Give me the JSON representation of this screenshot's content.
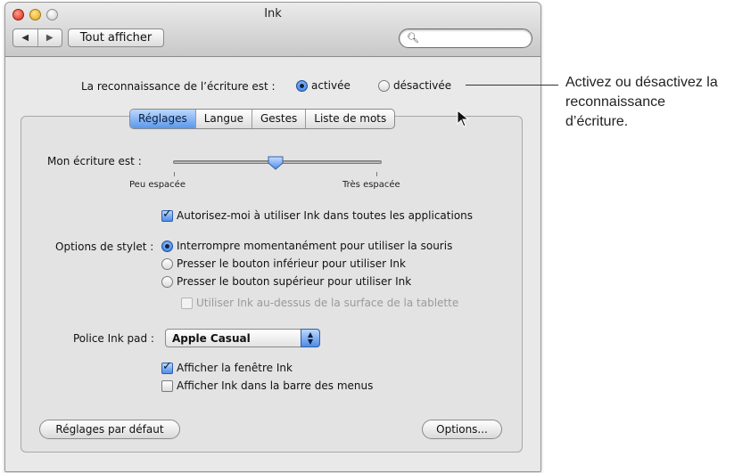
{
  "window": {
    "title": "Ink",
    "nav_back": "◀",
    "nav_forward": "▶",
    "show_all_label": "Tout afficher",
    "search_value": "",
    "search_icon": "magnifier-icon"
  },
  "recognition": {
    "label": "La reconnaissance de l’écriture est :",
    "on_label": "activée",
    "off_label": "désactivée",
    "selected": "activée"
  },
  "tabs": [
    {
      "label": "Réglages",
      "selected": true
    },
    {
      "label": "Langue",
      "selected": false
    },
    {
      "label": "Gestes",
      "selected": false
    },
    {
      "label": "Liste de mots",
      "selected": false
    }
  ],
  "settings": {
    "writing_label": "Mon écriture est :",
    "slider_min_label": "Peu espacée",
    "slider_max_label": "Très espacée",
    "slider_value": 0.45,
    "allow_all_apps_label": "Autorisez-moi à utiliser Ink dans toutes les applications",
    "allow_all_apps_checked": true,
    "stylus_label": "Options de stylet :",
    "stylus_options": [
      {
        "label": "Interrompre momentanément pour utiliser la souris",
        "selected": true
      },
      {
        "label": "Presser le bouton inférieur pour utiliser Ink",
        "selected": false
      },
      {
        "label": "Presser le bouton supérieur pour utiliser Ink",
        "selected": false
      }
    ],
    "above_tablet_label": "Utiliser Ink au-dessus de la surface de la tablette",
    "above_tablet_checked": false,
    "font_label": "Police Ink pad :",
    "font_value": "Apple Casual",
    "show_window_label": "Afficher la fenêtre Ink",
    "show_window_checked": true,
    "show_menubar_label": "Afficher Ink dans la barre des menus",
    "show_menubar_checked": false,
    "defaults_button": "Réglages par défaut",
    "options_button": "Options..."
  },
  "callout": {
    "text": "Activez ou désactivez la reconnaissance d’écriture."
  },
  "colors": {
    "accent": "#4e8ce6",
    "window_bg": "#e9e9e9"
  }
}
